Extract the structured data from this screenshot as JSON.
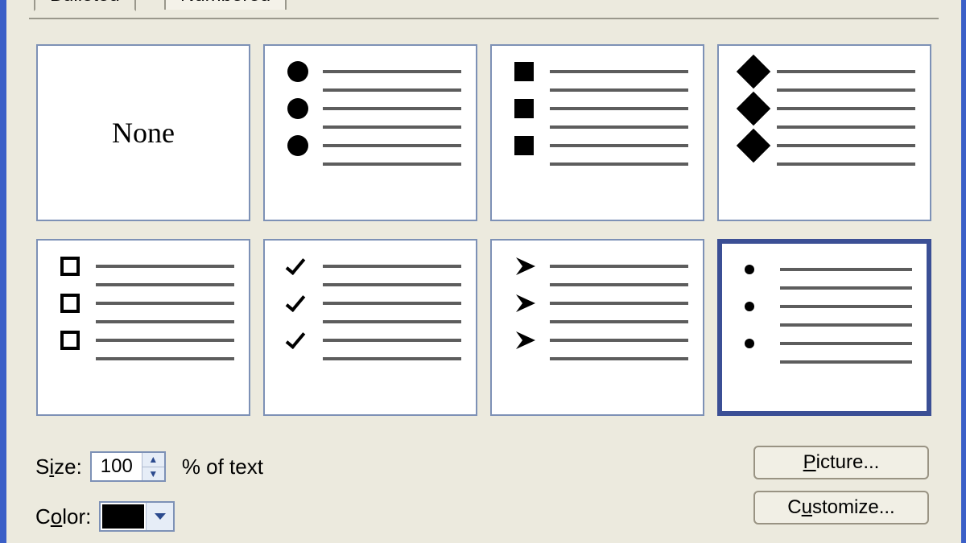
{
  "tabs": {
    "active": "Bulleted",
    "inactive": "Numbered"
  },
  "bullet_options": {
    "none_label": "None",
    "selected_index": 7,
    "items": [
      {
        "id": "none",
        "kind": "none",
        "icon_name": "none"
      },
      {
        "id": "disc",
        "kind": "filled-circle",
        "icon_name": "disc-icon"
      },
      {
        "id": "square",
        "kind": "filled-square",
        "icon_name": "square-icon"
      },
      {
        "id": "diamond",
        "kind": "filled-diamond",
        "icon_name": "diamond-icon"
      },
      {
        "id": "hollow-square",
        "kind": "hollow-square",
        "icon_name": "hollow-square-icon"
      },
      {
        "id": "checkmark",
        "kind": "checkmark",
        "icon_name": "checkmark-icon"
      },
      {
        "id": "arrowhead",
        "kind": "arrowhead",
        "icon_name": "arrowhead-icon"
      },
      {
        "id": "small-dot",
        "kind": "small-dot",
        "icon_name": "small-dot-icon"
      }
    ]
  },
  "size": {
    "label_pre": "S",
    "label_ul": "i",
    "label_post": "ze:",
    "value": "100",
    "suffix": "% of text"
  },
  "color": {
    "label_pre": "C",
    "label_ul": "o",
    "label_post": "lor:",
    "swatch": "#000000"
  },
  "buttons": {
    "picture": {
      "pre": "",
      "ul": "P",
      "post": "icture..."
    },
    "customize": {
      "pre": "C",
      "ul": "u",
      "post": "stomize..."
    }
  }
}
